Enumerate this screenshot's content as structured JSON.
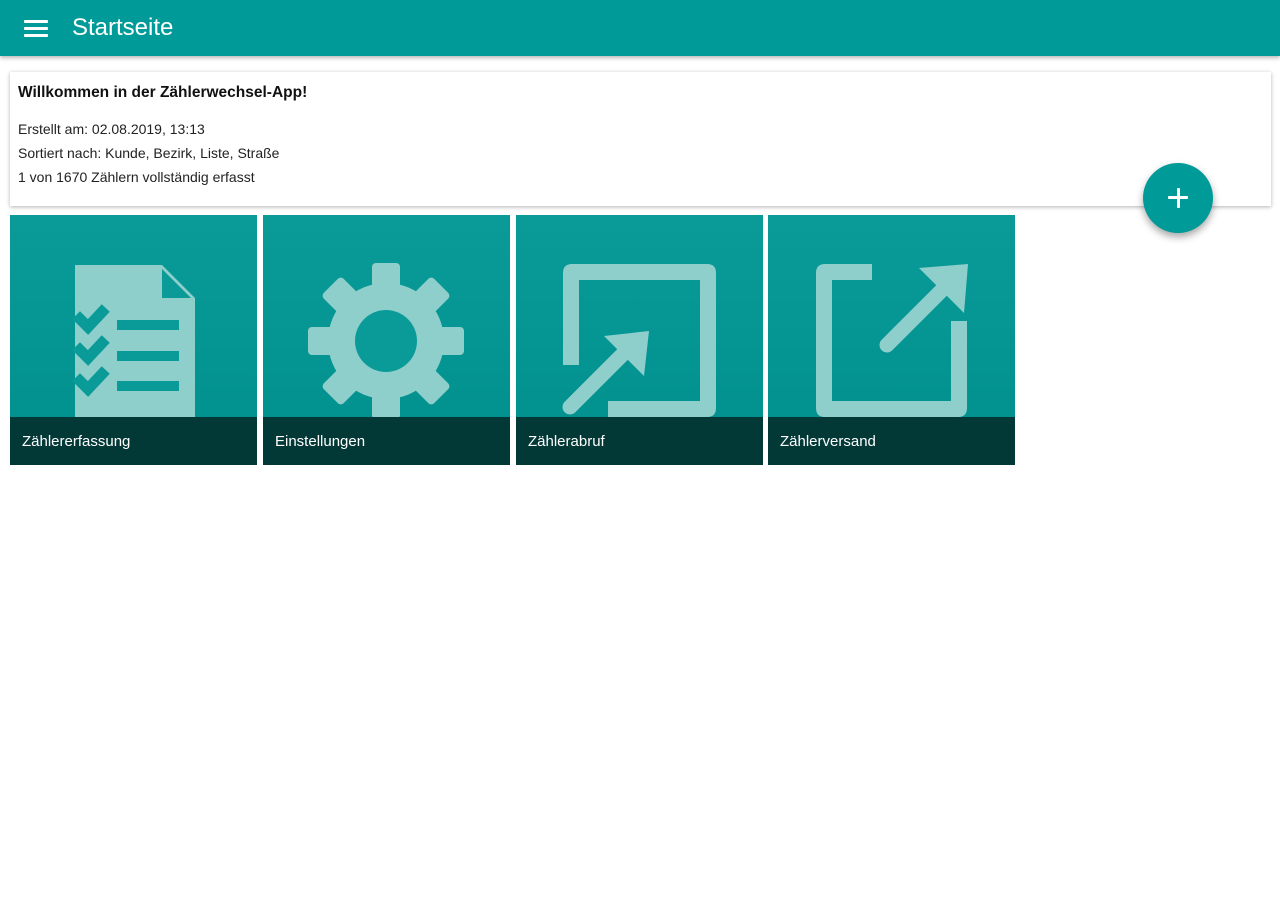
{
  "appbar": {
    "title": "Startseite",
    "menu_icon": "menu-icon",
    "color": "#009a98"
  },
  "welcome": {
    "title": "Willkommen in der Zählerwechsel-App!",
    "created": "Erstellt am: 02.08.2019, 13:13",
    "sorted": "Sortiert nach: Kunde, Bezirk, Liste, Straße",
    "progress": "1 von 1670 Zählern vollständig erfasst"
  },
  "fab": {
    "icon": "plus-icon"
  },
  "tiles": [
    {
      "label": "Zählererfassung",
      "icon": "checklist-document-icon"
    },
    {
      "label": "Einstellungen",
      "icon": "gear-icon"
    },
    {
      "label": "Zählerabruf",
      "icon": "import-arrow-icon"
    },
    {
      "label": "Zählerversand",
      "icon": "export-arrow-icon"
    }
  ],
  "colors": {
    "accent": "#009a98",
    "tile_label_bg": "#023836",
    "icon_tint": "#8ecfcc"
  }
}
